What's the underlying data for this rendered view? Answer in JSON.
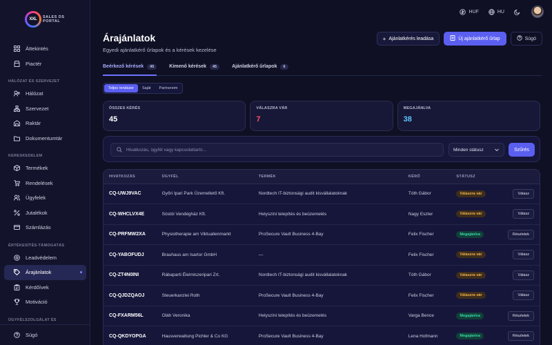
{
  "logo": {
    "mark": "XXL",
    "line1": "SALES DS",
    "line2": "PORTAL"
  },
  "topbar": {
    "currency": "HUF",
    "language": "HU"
  },
  "sidebar": {
    "top_items": [
      {
        "label": "Áttekintés",
        "icon": "grid-icon"
      },
      {
        "label": "Piactér",
        "icon": "store-icon"
      }
    ],
    "sections": [
      {
        "title": "HÁLÓZAT ÉS SZERVEZET",
        "items": [
          {
            "label": "Hálózat",
            "icon": "network-icon"
          },
          {
            "label": "Szervezet",
            "icon": "org-icon"
          },
          {
            "label": "Raktár",
            "icon": "warehouse-icon"
          },
          {
            "label": "Dokumentumtár",
            "icon": "folder-icon"
          }
        ]
      },
      {
        "title": "KERESKEDELEM",
        "items": [
          {
            "label": "Termékek",
            "icon": "box-icon"
          },
          {
            "label": "Rendelések",
            "icon": "cart-icon"
          },
          {
            "label": "Ügyfelek",
            "icon": "users-icon"
          },
          {
            "label": "Jutalékok",
            "icon": "percent-icon"
          },
          {
            "label": "Számlázás",
            "icon": "invoice-icon"
          }
        ]
      },
      {
        "title": "ÉRTÉKESÍTÉS-TÁMOGATÁS",
        "items": [
          {
            "label": "Leadvédelem",
            "icon": "shield-icon"
          },
          {
            "label": "Árajánlatok",
            "icon": "tag-icon",
            "active": true
          },
          {
            "label": "Kérdőívek",
            "icon": "clipboard-icon"
          },
          {
            "label": "Motiváció",
            "icon": "trophy-icon"
          }
        ]
      },
      {
        "title": "ÜGYFÉLSZOLGÁLAT ÉS",
        "items": []
      }
    ],
    "bottom": {
      "label": "Súgó",
      "icon": "help-icon"
    }
  },
  "header": {
    "title": "Árajánlatok",
    "subtitle": "Egyedi ajánlatkérő űrlapok és a kérések kezelése",
    "btn_submit": "Ajánlatkérés leadása",
    "btn_new_form": "Új ajánlatkérő űrlap",
    "btn_help": "Súgó"
  },
  "tabs": [
    {
      "label": "Beérkező kérések",
      "count": "45",
      "active": true
    },
    {
      "label": "Kimenő kérések",
      "count": "45"
    },
    {
      "label": "Ajánlatkérő űrlapok",
      "count": "6"
    }
  ],
  "segment": [
    {
      "label": "Teljes rendszer",
      "active": true
    },
    {
      "label": "Saját"
    },
    {
      "label": "Partnereim"
    }
  ],
  "stats": [
    {
      "label": "ÖSSZES KÉRÉS",
      "value": "45",
      "color": "#ffffff"
    },
    {
      "label": "VÁLASZRA VÁR",
      "value": "7",
      "color": "#ff4d62"
    },
    {
      "label": "MEGAJÁNLVA",
      "value": "38",
      "color": "#5fc4ff"
    }
  ],
  "filter": {
    "search_placeholder": "Hivatkozás, ügyfél vagy kapcsolattartó...",
    "status_select": "Minden státusz",
    "filter_button": "Szűrés"
  },
  "table": {
    "headers": [
      "HIVATKOZÁS",
      "ÜGYFÉL",
      "TERMÉK",
      "KÉRŐ",
      "STÁTUSZ",
      ""
    ],
    "rows": [
      {
        "ref": "CQ-UWJ9VAC",
        "client": "Győri Ipari Park Üzemeltető Kft.",
        "product": "Nordtech IT-biztonsági audit kisvállalatoknak",
        "requester": "Tóth Gábor",
        "status": "Válaszra vár",
        "status_type": "waiting",
        "action": "Válasz"
      },
      {
        "ref": "CQ-WHCLVX4E",
        "client": "Sóstói Vendégház Kft.",
        "product": "Helyszíni telepítés és beüzemelés",
        "requester": "Nagy Eszter",
        "status": "Válaszra vár",
        "status_type": "waiting",
        "action": "Válasz"
      },
      {
        "ref": "CQ-PRFMW2XA",
        "client": "Physiotherapie am Viktualienmarkt",
        "product": "ProSecure Vault Business 4-Bay",
        "requester": "Felix Fischer",
        "status": "Megajánlva",
        "status_type": "offered",
        "action": "Részletek"
      },
      {
        "ref": "CQ-YABOFUDJ",
        "client": "Brauhaus am Isartor GmbH",
        "product": "—",
        "requester": "Felix Fischer",
        "status": "Válaszra vár",
        "status_type": "waiting",
        "action": "Válasz"
      },
      {
        "ref": "CQ-ZT4N0INI",
        "client": "Rábaparti Élelmiszeripari Zrt.",
        "product": "Nordtech IT-biztonsági audit kisvállalatoknak",
        "requester": "Tóth Gábor",
        "status": "Válaszra vár",
        "status_type": "waiting",
        "action": "Válasz"
      },
      {
        "ref": "CQ-QJDZQAOJ",
        "client": "Steuerkanzlei Roth",
        "product": "ProSecure Vault Business 4-Bay",
        "requester": "Felix Fischer",
        "status": "Válaszra vár",
        "status_type": "waiting",
        "action": "Válasz"
      },
      {
        "ref": "CQ-FXARM56L",
        "client": "Oláh Veronika",
        "product": "Helyszíni telepítés és beüzemelés",
        "requester": "Varga Bence",
        "status": "Megajánlva",
        "status_type": "offered",
        "action": "Részletek"
      },
      {
        "ref": "CQ-QKDYOPGA",
        "client": "Hausverwaltung Pichler & Co KG",
        "product": "ProSecure Vault Business 4-Bay",
        "requester": "Lena Hofmann",
        "status": "Megajánlva",
        "status_type": "offered",
        "action": "Részletek"
      }
    ]
  }
}
